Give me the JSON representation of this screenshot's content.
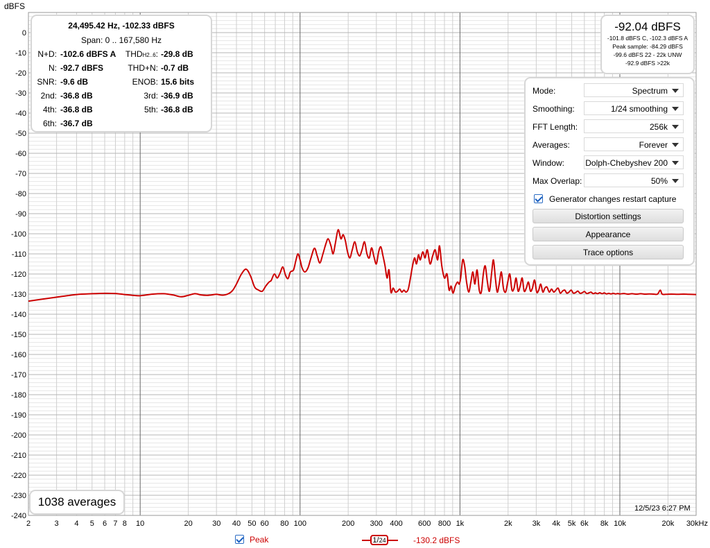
{
  "chart_data": {
    "type": "line",
    "title": "",
    "xlabel": "",
    "ylabel": "dBFS",
    "x_scale": "log",
    "xlim": [
      2,
      30000
    ],
    "ylim": [
      -240,
      10
    ],
    "grid": true,
    "x_ticks": [
      {
        "v": 2,
        "label": "2"
      },
      {
        "v": 3,
        "label": "3"
      },
      {
        "v": 4,
        "label": "4"
      },
      {
        "v": 5,
        "label": "5"
      },
      {
        "v": 6,
        "label": "6"
      },
      {
        "v": 7,
        "label": "7"
      },
      {
        "v": 8,
        "label": "8"
      },
      {
        "v": 10,
        "label": "10"
      },
      {
        "v": 20,
        "label": "20"
      },
      {
        "v": 30,
        "label": "30"
      },
      {
        "v": 40,
        "label": "40"
      },
      {
        "v": 50,
        "label": "50"
      },
      {
        "v": 60,
        "label": "60"
      },
      {
        "v": 80,
        "label": "80"
      },
      {
        "v": 100,
        "label": "100"
      },
      {
        "v": 200,
        "label": "200"
      },
      {
        "v": 300,
        "label": "300"
      },
      {
        "v": 400,
        "label": "400"
      },
      {
        "v": 600,
        "label": "600"
      },
      {
        "v": 800,
        "label": "800"
      },
      {
        "v": 1000,
        "label": "1k"
      },
      {
        "v": 2000,
        "label": "2k"
      },
      {
        "v": 3000,
        "label": "3k"
      },
      {
        "v": 4000,
        "label": "4k"
      },
      {
        "v": 5000,
        "label": "5k"
      },
      {
        "v": 6000,
        "label": "6k"
      },
      {
        "v": 8000,
        "label": "8k"
      },
      {
        "v": 10000,
        "label": "10k"
      },
      {
        "v": 20000,
        "label": "20k"
      },
      {
        "v": 30000,
        "label": "30kHz"
      }
    ],
    "y_ticks": [
      0,
      -10,
      -20,
      -30,
      -40,
      -50,
      -60,
      -70,
      -80,
      -90,
      -100,
      -110,
      -120,
      -130,
      -140,
      -150,
      -160,
      -170,
      -180,
      -190,
      -200,
      -210,
      -220,
      -230,
      -240
    ],
    "series": [
      {
        "name": "Peak",
        "color": "#cc0000",
        "points": [
          [
            2,
            -133.5
          ],
          [
            3,
            -131.5
          ],
          [
            4,
            -130.2
          ],
          [
            5,
            -129.8
          ],
          [
            6,
            -129.6
          ],
          [
            7,
            -129.7
          ],
          [
            8,
            -130.2
          ],
          [
            9,
            -130.6
          ],
          [
            10,
            -130.8
          ],
          [
            12,
            -130.0
          ],
          [
            14,
            -129.8
          ],
          [
            16,
            -130.4
          ],
          [
            18,
            -131.3
          ],
          [
            20,
            -130.6
          ],
          [
            22,
            -129.8
          ],
          [
            24,
            -130.4
          ],
          [
            26,
            -130.6
          ],
          [
            28,
            -130.4
          ],
          [
            30,
            -130.1
          ],
          [
            33,
            -130.5
          ],
          [
            36,
            -129.6
          ],
          [
            38,
            -128.0
          ],
          [
            40,
            -125.0
          ],
          [
            43,
            -120.0
          ],
          [
            46,
            -117.6
          ],
          [
            49,
            -121.0
          ],
          [
            52,
            -126.5
          ],
          [
            55,
            -128.0
          ],
          [
            58,
            -128.6
          ],
          [
            61,
            -126.0
          ],
          [
            64,
            -124.0
          ],
          [
            66,
            -123.2
          ],
          [
            69,
            -120.0
          ],
          [
            72,
            -122.0
          ],
          [
            75,
            -119.5
          ],
          [
            78,
            -116.5
          ],
          [
            81,
            -120.5
          ],
          [
            84,
            -122.3
          ],
          [
            87,
            -119.0
          ],
          [
            91,
            -118.0
          ],
          [
            94,
            -113.5
          ],
          [
            97,
            -110.0
          ],
          [
            100,
            -113.0
          ],
          [
            103,
            -117.0
          ],
          [
            107,
            -119.0
          ],
          [
            112,
            -117.0
          ],
          [
            117,
            -112.0
          ],
          [
            123,
            -107.2
          ],
          [
            128,
            -111.0
          ],
          [
            133,
            -114.5
          ],
          [
            139,
            -110.0
          ],
          [
            145,
            -105.0
          ],
          [
            150,
            -102.5
          ],
          [
            156,
            -106.0
          ],
          [
            161,
            -110.0
          ],
          [
            166,
            -105.0
          ],
          [
            173,
            -98.0
          ],
          [
            180,
            -102.5
          ],
          [
            186,
            -100.5
          ],
          [
            192,
            -103.5
          ],
          [
            198,
            -109.0
          ],
          [
            205,
            -112.0
          ],
          [
            212,
            -108.0
          ],
          [
            220,
            -104.0
          ],
          [
            228,
            -109.0
          ],
          [
            236,
            -111.0
          ],
          [
            244,
            -108.0
          ],
          [
            253,
            -104.0
          ],
          [
            262,
            -110.0
          ],
          [
            271,
            -112.0
          ],
          [
            280,
            -107.0
          ],
          [
            290,
            -111.5
          ],
          [
            300,
            -115.0
          ],
          [
            310,
            -109.0
          ],
          [
            320,
            -106.5
          ],
          [
            330,
            -111.0
          ],
          [
            340,
            -116.0
          ],
          [
            350,
            -122.0
          ],
          [
            360,
            -118.0
          ],
          [
            370,
            -129.0
          ],
          [
            382,
            -127.0
          ],
          [
            395,
            -129.0
          ],
          [
            408,
            -128.5
          ],
          [
            420,
            -127.5
          ],
          [
            433,
            -129.0
          ],
          [
            446,
            -128.0
          ],
          [
            460,
            -129.0
          ],
          [
            475,
            -127.5
          ],
          [
            490,
            -122.0
          ],
          [
            505,
            -116.0
          ],
          [
            520,
            -112.0
          ],
          [
            535,
            -115.0
          ],
          [
            550,
            -110.5
          ],
          [
            565,
            -113.0
          ],
          [
            585,
            -109.0
          ],
          [
            605,
            -112.0
          ],
          [
            625,
            -108.0
          ],
          [
            650,
            -115.0
          ],
          [
            675,
            -111.0
          ],
          [
            700,
            -108.0
          ],
          [
            725,
            -113.0
          ],
          [
            745,
            -106.0
          ],
          [
            770,
            -116.0
          ],
          [
            800,
            -122.0
          ],
          [
            830,
            -120.0
          ],
          [
            855,
            -128.0
          ],
          [
            880,
            -126.0
          ],
          [
            905,
            -129.5
          ],
          [
            935,
            -126.0
          ],
          [
            965,
            -124.0
          ],
          [
            990,
            -125.0
          ],
          [
            1010,
            -122.0
          ],
          [
            1040,
            -113.0
          ],
          [
            1070,
            -116.0
          ],
          [
            1100,
            -124.0
          ],
          [
            1135,
            -129.0
          ],
          [
            1170,
            -124.0
          ],
          [
            1205,
            -119.0
          ],
          [
            1240,
            -125.0
          ],
          [
            1280,
            -118.0
          ],
          [
            1320,
            -128.0
          ],
          [
            1360,
            -129.0
          ],
          [
            1400,
            -120.0
          ],
          [
            1440,
            -116.0
          ],
          [
            1485,
            -124.0
          ],
          [
            1530,
            -128.5
          ],
          [
            1580,
            -119.0
          ],
          [
            1620,
            -113.0
          ],
          [
            1665,
            -122.0
          ],
          [
            1710,
            -129.0
          ],
          [
            1760,
            -125.0
          ],
          [
            1815,
            -119.0
          ],
          [
            1870,
            -127.0
          ],
          [
            1930,
            -129.0
          ],
          [
            1990,
            -124.0
          ],
          [
            2050,
            -120.0
          ],
          [
            2115,
            -128.0
          ],
          [
            2180,
            -127.0
          ],
          [
            2245,
            -122.0
          ],
          [
            2310,
            -128.5
          ],
          [
            2380,
            -126.0
          ],
          [
            2450,
            -122.0
          ],
          [
            2520,
            -128.5
          ],
          [
            2600,
            -127.0
          ],
          [
            2680,
            -124.0
          ],
          [
            2760,
            -128.5
          ],
          [
            2840,
            -127.0
          ],
          [
            2930,
            -123.0
          ],
          [
            3020,
            -129.0
          ],
          [
            3110,
            -128.0
          ],
          [
            3200,
            -125.0
          ],
          [
            3300,
            -129.0
          ],
          [
            3400,
            -127.0
          ],
          [
            3500,
            -126.5
          ],
          [
            3620,
            -129.0
          ],
          [
            3740,
            -127.5
          ],
          [
            3860,
            -129.0
          ],
          [
            3980,
            -128.0
          ],
          [
            4110,
            -127.0
          ],
          [
            4240,
            -129.5
          ],
          [
            4380,
            -128.5
          ],
          [
            4520,
            -128.0
          ],
          [
            4660,
            -129.5
          ],
          [
            4810,
            -129.0
          ],
          [
            4960,
            -128.0
          ],
          [
            5120,
            -129.5
          ],
          [
            5290,
            -129.2
          ],
          [
            5460,
            -128.5
          ],
          [
            5640,
            -129.6
          ],
          [
            5820,
            -129.3
          ],
          [
            6010,
            -128.7
          ],
          [
            6200,
            -129.7
          ],
          [
            6400,
            -129.4
          ],
          [
            6600,
            -129.0
          ],
          [
            6810,
            -129.8
          ],
          [
            7030,
            -129.4
          ],
          [
            7260,
            -129.8
          ],
          [
            7490,
            -129.3
          ],
          [
            7740,
            -129.8
          ],
          [
            7990,
            -129.4
          ],
          [
            8250,
            -129.9
          ],
          [
            8520,
            -129.6
          ],
          [
            8800,
            -129.9
          ],
          [
            9100,
            -129.6
          ],
          [
            9400,
            -129.9
          ],
          [
            9700,
            -129.7
          ],
          [
            10000,
            -129.9
          ],
          [
            10600,
            -129.7
          ],
          [
            11200,
            -130.0
          ],
          [
            11900,
            -129.8
          ],
          [
            12700,
            -130.0
          ],
          [
            13500,
            -129.8
          ],
          [
            14400,
            -130.0
          ],
          [
            15300,
            -129.9
          ],
          [
            16300,
            -130.0
          ],
          [
            17200,
            -130.0
          ],
          [
            17900,
            -128.0
          ],
          [
            18400,
            -130.0
          ],
          [
            19500,
            -130.1
          ],
          [
            21000,
            -130.0
          ],
          [
            23000,
            -130.1
          ],
          [
            25000,
            -130.0
          ],
          [
            27000,
            -130.1
          ],
          [
            30000,
            -130.2
          ]
        ]
      }
    ]
  },
  "stats_panel": {
    "header": "24,495.42 Hz, -102.33 dBFS",
    "span": "Span: 0 .. 167,580 Hz",
    "rows": [
      {
        "l1": "N+D:",
        "v1": "-102.6 dBFS A",
        "l2": "THD",
        "l2sub": "H2..6",
        "l2end": ":",
        "v2": "-29.8 dB"
      },
      {
        "l1": "N:",
        "v1": "-92.7 dBFS",
        "l2": "THD+N:",
        "v2": "-0.7 dB"
      },
      {
        "l1": "SNR:",
        "v1": "-9.6 dB",
        "l2": "ENOB:",
        "v2": "15.6 bits"
      },
      {
        "l1": "2nd:",
        "v1": "-36.8 dB",
        "l2": "3rd:",
        "v2": "-36.9 dB"
      },
      {
        "l1": "4th:",
        "v1": "-36.8 dB",
        "l2": "5th:",
        "v2": "-36.8 dB"
      },
      {
        "l1": "6th:",
        "v1": "-36.7 dB"
      }
    ]
  },
  "summary_panel": {
    "main": "-92.04 dBFS",
    "lines": [
      "-101.8 dBFS C, -102.3 dBFS A",
      "Peak sample: -84.29 dBFS",
      "-99.6 dBFS 22 - 22k UNW",
      "-92.9 dBFS >22k"
    ]
  },
  "settings_panel": {
    "rows": [
      {
        "label": "Mode:",
        "value": "Spectrum"
      },
      {
        "label": "Smoothing:",
        "value": "1/24 smoothing"
      },
      {
        "label": "FFT Length:",
        "value": "256k"
      },
      {
        "label": "Averages:",
        "value": "Forever"
      },
      {
        "label": "Window:",
        "value": "Dolph-Chebyshev 200"
      },
      {
        "label": "Max Overlap:",
        "value": "50%"
      }
    ],
    "checkbox_label": "Generator changes restart capture",
    "checkbox_checked": true,
    "buttons": [
      "Distortion settings",
      "Appearance",
      "Trace options"
    ]
  },
  "averages_badge": "1038 averages",
  "timestamp": "12/5/23 6:27 PM",
  "legend": {
    "peak_label": "Peak",
    "smoothing_num": "1",
    "smoothing_den": "24",
    "level": "-130.2 dBFS"
  }
}
